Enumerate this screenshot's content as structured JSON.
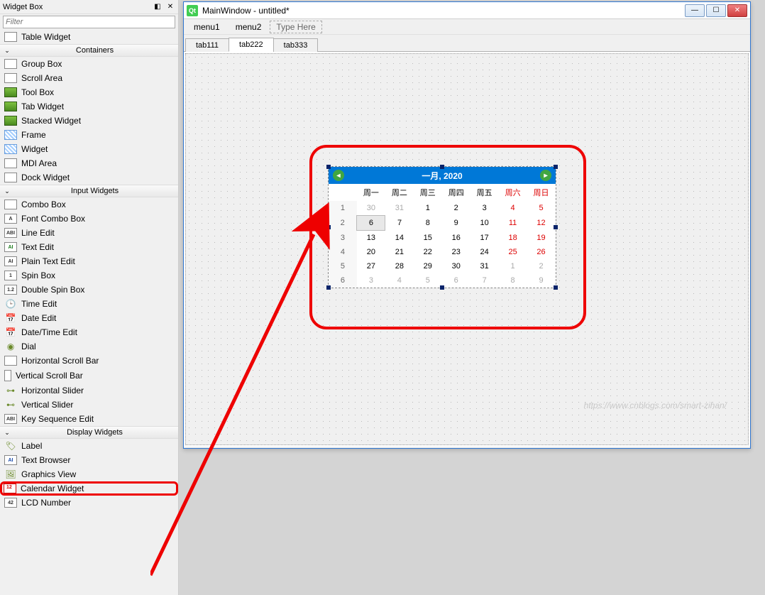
{
  "panel": {
    "title": "Widget Box",
    "filter_placeholder": "Filter"
  },
  "widgets_top": {
    "table_widget": "Table Widget"
  },
  "sections": {
    "containers": "Containers",
    "input_widgets": "Input Widgets",
    "display_widgets": "Display Widgets"
  },
  "containers": {
    "group_box": "Group Box",
    "scroll_area": "Scroll Area",
    "tool_box": "Tool Box",
    "tab_widget": "Tab Widget",
    "stacked_widget": "Stacked Widget",
    "frame": "Frame",
    "widget": "Widget",
    "mdi_area": "MDI Area",
    "dock_widget": "Dock Widget"
  },
  "input_widgets": {
    "combo_box": "Combo Box",
    "font_combo_box": "Font Combo Box",
    "line_edit": "Line Edit",
    "text_edit": "Text Edit",
    "plain_text_edit": "Plain Text Edit",
    "spin_box": "Spin Box",
    "double_spin_box": "Double Spin Box",
    "time_edit": "Time Edit",
    "date_edit": "Date Edit",
    "date_time_edit": "Date/Time Edit",
    "dial": "Dial",
    "horizontal_scroll_bar": "Horizontal Scroll Bar",
    "vertical_scroll_bar": "Vertical Scroll Bar",
    "horizontal_slider": "Horizontal Slider",
    "vertical_slider": "Vertical Slider",
    "key_sequence_edit": "Key Sequence Edit"
  },
  "display_widgets": {
    "label": "Label",
    "text_browser": "Text Browser",
    "graphics_view": "Graphics View",
    "calendar_widget": "Calendar Widget",
    "lcd_number": "LCD Number"
  },
  "main_window": {
    "title": "MainWindow - untitled*",
    "menu1": "menu1",
    "menu2": "menu2",
    "type_here": "Type Here",
    "tab1": "tab111",
    "tab2": "tab222",
    "tab3": "tab333"
  },
  "calendar": {
    "month_year": "一月,  2020",
    "days": {
      "mon": "周一",
      "tue": "周二",
      "wed": "周三",
      "thu": "周四",
      "fri": "周五",
      "sat": "周六",
      "sun": "周日"
    },
    "weeks": [
      "1",
      "2",
      "3",
      "4",
      "5",
      "6"
    ],
    "rows": [
      [
        {
          "v": "30",
          "g": true
        },
        {
          "v": "31",
          "g": true
        },
        {
          "v": "1"
        },
        {
          "v": "2"
        },
        {
          "v": "3"
        },
        {
          "v": "4",
          "r": true
        },
        {
          "v": "5",
          "r": true
        }
      ],
      [
        {
          "v": "6",
          "t": true
        },
        {
          "v": "7"
        },
        {
          "v": "8"
        },
        {
          "v": "9"
        },
        {
          "v": "10"
        },
        {
          "v": "11",
          "r": true
        },
        {
          "v": "12",
          "r": true
        }
      ],
      [
        {
          "v": "13"
        },
        {
          "v": "14"
        },
        {
          "v": "15"
        },
        {
          "v": "16"
        },
        {
          "v": "17"
        },
        {
          "v": "18",
          "r": true
        },
        {
          "v": "19",
          "r": true
        }
      ],
      [
        {
          "v": "20"
        },
        {
          "v": "21"
        },
        {
          "v": "22"
        },
        {
          "v": "23"
        },
        {
          "v": "24"
        },
        {
          "v": "25",
          "r": true
        },
        {
          "v": "26",
          "r": true
        }
      ],
      [
        {
          "v": "27"
        },
        {
          "v": "28"
        },
        {
          "v": "29"
        },
        {
          "v": "30"
        },
        {
          "v": "31"
        },
        {
          "v": "1",
          "g": true
        },
        {
          "v": "2",
          "g": true
        }
      ],
      [
        {
          "v": "3",
          "g": true
        },
        {
          "v": "4",
          "g": true
        },
        {
          "v": "5",
          "g": true
        },
        {
          "v": "6",
          "g": true
        },
        {
          "v": "7",
          "g": true
        },
        {
          "v": "8",
          "g": true
        },
        {
          "v": "9",
          "g": true
        }
      ]
    ]
  },
  "watermark": "https://www.cnblogs.com/smart-zihan/"
}
